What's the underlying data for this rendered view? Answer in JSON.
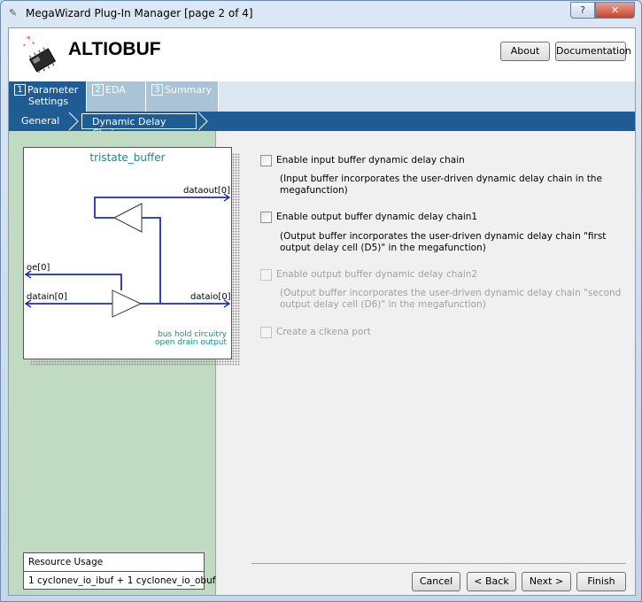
{
  "window": {
    "title": "MegaWizard Plug-In Manager [page 2 of 4]",
    "help_label": "?",
    "close_label": "✕"
  },
  "header": {
    "app_name": "ALTIOBUF",
    "about_label": "About",
    "documentation_label": "Documentation"
  },
  "tabs": [
    {
      "num": "1",
      "label": "Parameter",
      "label2": "Settings",
      "active": true
    },
    {
      "num": "2",
      "label": "EDA",
      "active": false
    },
    {
      "num": "3",
      "label": "Summary",
      "active": false
    }
  ],
  "breadcrumbs": {
    "general": "General",
    "current": "Dynamic Delay Chains"
  },
  "diagram": {
    "title": "tristate_buffer",
    "ports": {
      "dataout": "dataout[0]",
      "oe": "oe[0]",
      "datain": "datain[0]",
      "dataio": "dataio[0]"
    },
    "notes": [
      "bus hold circuitry",
      "open drain output"
    ]
  },
  "resource": {
    "title": "Resource Usage",
    "value": "1 cyclonev_io_ibuf + 1 cyclonev_io_obuf"
  },
  "options": [
    {
      "label": "Enable input buffer dynamic delay chain",
      "desc": "(Input buffer incorporates the user-driven dynamic delay chain in the megafunction)",
      "checked": false,
      "enabled": true
    },
    {
      "label": "Enable output buffer dynamic delay chain1",
      "desc": "(Output buffer incorporates the user-driven dynamic delay chain \"first output delay cell (D5)\" in the megafunction)",
      "checked": false,
      "enabled": true
    },
    {
      "label": "Enable output buffer dynamic delay chain2",
      "desc": "(Output buffer incorporates the user-driven dynamic delay chain \"second output delay cell (D6)\" in the megafunction)",
      "checked": false,
      "enabled": false
    },
    {
      "label": "Create a clkena port",
      "checked": false,
      "enabled": false
    }
  ],
  "footer": {
    "cancel": "Cancel",
    "back": "< Back",
    "next": "Next >",
    "finish": "Finish"
  },
  "colors": {
    "accent": "#1f5c94",
    "left_panel": "#c1dbc2",
    "wire": "#1c2fa8",
    "diagram_title": "#1a8a8a"
  }
}
